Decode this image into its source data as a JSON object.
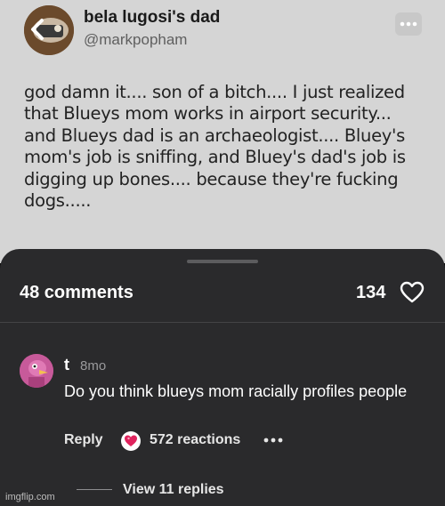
{
  "tweet": {
    "display_name": "bela lugosi's dad",
    "handle": "@markpopham",
    "text": "god damn it.... son of a bitch.... I just realized that Blueys mom works in airport security... and Blueys dad is an archaeologist.... Bluey's mom's job is sniffing, and Bluey's dad's job is digging up bones.... because they're fucking dogs....."
  },
  "sheet": {
    "comments_count": "48 comments",
    "likes_count": "134"
  },
  "comment": {
    "author": "t",
    "time": "8mo",
    "text": "Do you think blueys mom racially profiles people",
    "reply_label": "Reply",
    "reactions": "572 reactions",
    "view_replies": "View 11 replies"
  },
  "watermark": "imgflip.com",
  "colors": {
    "tweet_bg": "#d5d5d5",
    "sheet_bg": "#2a2a2c",
    "reaction_heart": "#e0245e"
  },
  "icons": {
    "back": "chevron-left-icon",
    "tweet_menu": "more-horizontal-icon",
    "like": "heart-outline-icon",
    "reaction": "heart-reaction-icon",
    "comment_menu": "more-horizontal-icon"
  }
}
